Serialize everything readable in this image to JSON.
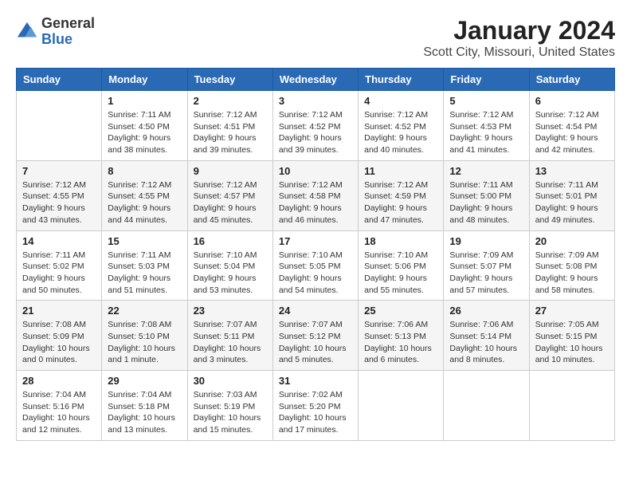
{
  "header": {
    "logo_general": "General",
    "logo_blue": "Blue",
    "title": "January 2024",
    "subtitle": "Scott City, Missouri, United States"
  },
  "weekdays": [
    "Sunday",
    "Monday",
    "Tuesday",
    "Wednesday",
    "Thursday",
    "Friday",
    "Saturday"
  ],
  "weeks": [
    [
      {
        "day": "",
        "info": ""
      },
      {
        "day": "1",
        "info": "Sunrise: 7:11 AM\nSunset: 4:50 PM\nDaylight: 9 hours\nand 38 minutes."
      },
      {
        "day": "2",
        "info": "Sunrise: 7:12 AM\nSunset: 4:51 PM\nDaylight: 9 hours\nand 39 minutes."
      },
      {
        "day": "3",
        "info": "Sunrise: 7:12 AM\nSunset: 4:52 PM\nDaylight: 9 hours\nand 39 minutes."
      },
      {
        "day": "4",
        "info": "Sunrise: 7:12 AM\nSunset: 4:52 PM\nDaylight: 9 hours\nand 40 minutes."
      },
      {
        "day": "5",
        "info": "Sunrise: 7:12 AM\nSunset: 4:53 PM\nDaylight: 9 hours\nand 41 minutes."
      },
      {
        "day": "6",
        "info": "Sunrise: 7:12 AM\nSunset: 4:54 PM\nDaylight: 9 hours\nand 42 minutes."
      }
    ],
    [
      {
        "day": "7",
        "info": ""
      },
      {
        "day": "8",
        "info": "Sunrise: 7:12 AM\nSunset: 4:55 PM\nDaylight: 9 hours\nand 44 minutes."
      },
      {
        "day": "9",
        "info": "Sunrise: 7:12 AM\nSunset: 4:57 PM\nDaylight: 9 hours\nand 45 minutes."
      },
      {
        "day": "10",
        "info": "Sunrise: 7:12 AM\nSunset: 4:58 PM\nDaylight: 9 hours\nand 46 minutes."
      },
      {
        "day": "11",
        "info": "Sunrise: 7:12 AM\nSunset: 4:59 PM\nDaylight: 9 hours\nand 47 minutes."
      },
      {
        "day": "12",
        "info": "Sunrise: 7:11 AM\nSunset: 5:00 PM\nDaylight: 9 hours\nand 48 minutes."
      },
      {
        "day": "13",
        "info": "Sunrise: 7:11 AM\nSunset: 5:01 PM\nDaylight: 9 hours\nand 49 minutes."
      }
    ],
    [
      {
        "day": "14",
        "info": ""
      },
      {
        "day": "15",
        "info": "Sunrise: 7:11 AM\nSunset: 5:03 PM\nDaylight: 9 hours\nand 51 minutes."
      },
      {
        "day": "16",
        "info": "Sunrise: 7:10 AM\nSunset: 5:04 PM\nDaylight: 9 hours\nand 53 minutes."
      },
      {
        "day": "17",
        "info": "Sunrise: 7:10 AM\nSunset: 5:05 PM\nDaylight: 9 hours\nand 54 minutes."
      },
      {
        "day": "18",
        "info": "Sunrise: 7:10 AM\nSunset: 5:06 PM\nDaylight: 9 hours\nand 55 minutes."
      },
      {
        "day": "19",
        "info": "Sunrise: 7:09 AM\nSunset: 5:07 PM\nDaylight: 9 hours\nand 57 minutes."
      },
      {
        "day": "20",
        "info": "Sunrise: 7:09 AM\nSunset: 5:08 PM\nDaylight: 9 hours\nand 58 minutes."
      }
    ],
    [
      {
        "day": "21",
        "info": ""
      },
      {
        "day": "22",
        "info": "Sunrise: 7:08 AM\nSunset: 5:10 PM\nDaylight: 10 hours\nand 1 minute."
      },
      {
        "day": "23",
        "info": "Sunrise: 7:07 AM\nSunset: 5:11 PM\nDaylight: 10 hours\nand 3 minutes."
      },
      {
        "day": "24",
        "info": "Sunrise: 7:07 AM\nSunset: 5:12 PM\nDaylight: 10 hours\nand 5 minutes."
      },
      {
        "day": "25",
        "info": "Sunrise: 7:06 AM\nSunset: 5:13 PM\nDaylight: 10 hours\nand 6 minutes."
      },
      {
        "day": "26",
        "info": "Sunrise: 7:06 AM\nSunset: 5:14 PM\nDaylight: 10 hours\nand 8 minutes."
      },
      {
        "day": "27",
        "info": "Sunrise: 7:05 AM\nSunset: 5:15 PM\nDaylight: 10 hours\nand 10 minutes."
      }
    ],
    [
      {
        "day": "28",
        "info": ""
      },
      {
        "day": "29",
        "info": "Sunrise: 7:04 AM\nSunset: 5:18 PM\nDaylight: 10 hours\nand 13 minutes."
      },
      {
        "day": "30",
        "info": "Sunrise: 7:03 AM\nSunset: 5:19 PM\nDaylight: 10 hours\nand 15 minutes."
      },
      {
        "day": "31",
        "info": "Sunrise: 7:02 AM\nSunset: 5:20 PM\nDaylight: 10 hours\nand 17 minutes."
      },
      {
        "day": "",
        "info": ""
      },
      {
        "day": "",
        "info": ""
      },
      {
        "day": "",
        "info": ""
      }
    ]
  ],
  "week1_day7_info": "Sunrise: 7:12 AM\nSunset: 4:55 PM\nDaylight: 9 hours\nand 43 minutes.",
  "week2_day14_info": "Sunrise: 7:11 AM\nSunset: 5:02 PM\nDaylight: 9 hours\nand 50 minutes.",
  "week3_day21_info": "Sunrise: 7:08 AM\nSunset: 5:09 PM\nDaylight: 10 hours\nand 0 minutes.",
  "week4_day28_info": "Sunrise: 7:04 AM\nSunset: 5:16 PM\nDaylight: 10 hours\nand 12 minutes."
}
